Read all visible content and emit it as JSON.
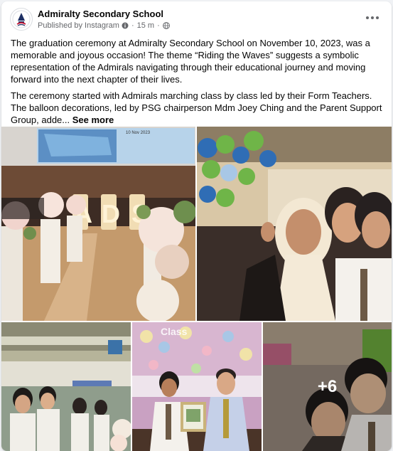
{
  "post": {
    "author": "Admiralty Secondary School",
    "published_by": "Published by Instagram",
    "time": "15 m",
    "paragraph1": "The graduation ceremony at Admiralty Secondary School on November 10, 2023, was a memorable and joyous occasion! The theme “Riding the Waves” suggests a symbolic representation of the Admirals navigating through their educational journey and moving forward into the next chapter of their lives.",
    "paragraph2": "The ceremony started with Admirals marching class by class led by their Form Teachers. The balloon decorations, led by PSG chairperson Mdm Joey Ching and the Parent Support Group, adde...",
    "see_more": "See more",
    "more_photos": "+6"
  },
  "photos": {
    "screen_date": "10 Nov 2023",
    "ads_letters": [
      "A",
      "D",
      "S"
    ],
    "sign_text": "Class"
  },
  "icons": {
    "avatar": "school-crest-icon",
    "info": "info-icon",
    "audience": "globe-icon",
    "more": "more-options-icon"
  }
}
